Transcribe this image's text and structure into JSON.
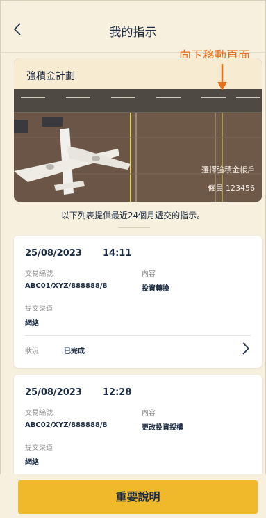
{
  "header": {
    "title": "我的指示",
    "back_icon": "chevron-left-icon"
  },
  "annotation": {
    "text": "向下移動頁面",
    "color": "#e8701f"
  },
  "plan": {
    "name": "強積金計劃",
    "select_account": "選擇強積金帳戶",
    "member_label": "僱員 123456"
  },
  "intro": "以下列表提供最近24個月遞交的指示。",
  "instructions": [
    {
      "date": "25/08/2023",
      "time": "14:11",
      "ref_label": "交易編號",
      "ref_value": "ABC01/XYZ/888888/8",
      "content_label": "內容",
      "content_value": "投資轉換",
      "channel_label": "提交渠道",
      "channel_value": "網絡",
      "status_label": "狀況",
      "status_value": "已完成"
    },
    {
      "date": "25/08/2023",
      "time": "12:28",
      "ref_label": "交易編號",
      "ref_value": "ABC02/XYZ/888888/8",
      "content_label": "內容",
      "content_value": "更改投資授權",
      "channel_label": "提交渠道",
      "channel_value": "網絡"
    }
  ],
  "footer": {
    "button_label": "重要說明",
    "button_color": "#f0b92c"
  }
}
